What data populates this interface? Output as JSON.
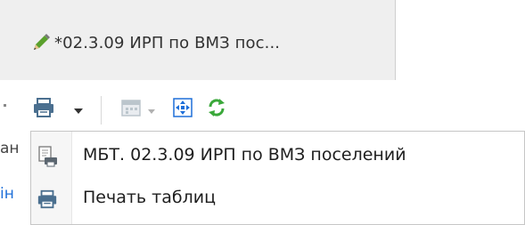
{
  "tab": {
    "title": "*02.3.09 ИРП по ВМЗ пос..."
  },
  "toolbar": {
    "print": "printer-icon",
    "print_dropdown": "caret-down-icon",
    "calendar": "calendar-icon",
    "calendar_dropdown": "caret-down-icon",
    "navigate": "move-arrows-icon",
    "refresh": "refresh-icon"
  },
  "menu": {
    "items": [
      {
        "label": "МБТ. 02.3.09 ИРП по ВМЗ поселений",
        "icon": "report-printer-icon"
      },
      {
        "label": "Печать таблиц",
        "icon": "printer-icon"
      }
    ]
  },
  "background_edge": {
    "row1": "ан",
    "row2": "ін"
  },
  "colors": {
    "tab_bg": "#efefef",
    "accent_green": "#3aa83a",
    "accent_blue": "#1e6fd9",
    "menu_border": "#c6c6c6"
  }
}
